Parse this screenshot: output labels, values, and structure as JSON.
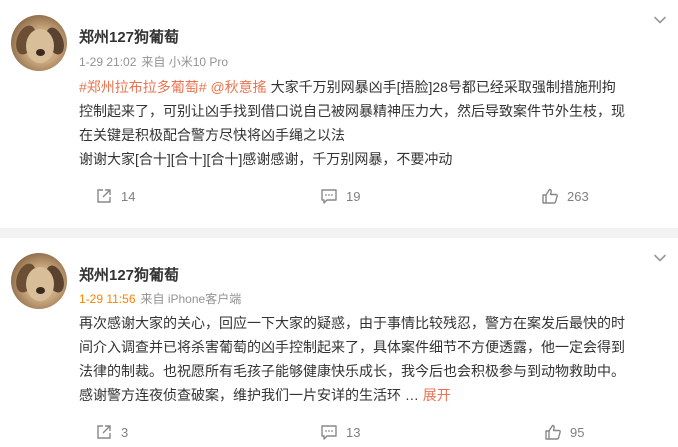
{
  "posts": [
    {
      "username": "郑州127狗葡萄",
      "time": "1-29 21:02",
      "source": "来自 小米10 Pro",
      "content": {
        "line1_tag": "#郑州拉布拉多葡萄#",
        "line1_mention": "@秋意搖",
        "line1_text": " 大家千万别网暴凶手[捂脸]28号都已经采取强制措施刑拘",
        "line2": "控制起来了，可别让凶手找到借口说自己被网暴精神压力大，然后导致案件节外生枝，现",
        "line3": "在关键是积极配合警方尽快将凶手绳之以法",
        "line4": "谢谢大家[合十][合十][合十]感谢感谢，千万别网暴，不要冲动"
      },
      "repost_count": "14",
      "comment_count": "19",
      "like_count": "263"
    },
    {
      "username": "郑州127狗葡萄",
      "time": "1-29 11:56",
      "source": "来自 iPhone客户端",
      "content": {
        "line1": "再次感谢大家的关心，回应一下大家的疑惑，由于事情比较残忍，警方在案发后最快的时",
        "line2": "间介入调查并已将杀害葡萄的凶手控制起来了，具体案件细节不方便透露，他一定会得到",
        "line3": "法律的制裁。也祝愿所有毛孩子能够健康快乐成长，我今后也会积极参与到动物救助中。",
        "line4": "感谢警方连夜侦查破案，维护我们一片安详的生活环",
        "more_label": "展开"
      },
      "repost_count": "3",
      "comment_count": "13",
      "like_count": "95"
    }
  ],
  "icons": {
    "repost": "share-arrow-icon",
    "comment": "comment-icon",
    "like": "thumbs-up-icon",
    "menu": "chevron-down-icon"
  },
  "colors": {
    "topic": "#eb7350",
    "time_highlight": "#ff8200",
    "meta": "#939393",
    "action": "#808080"
  }
}
